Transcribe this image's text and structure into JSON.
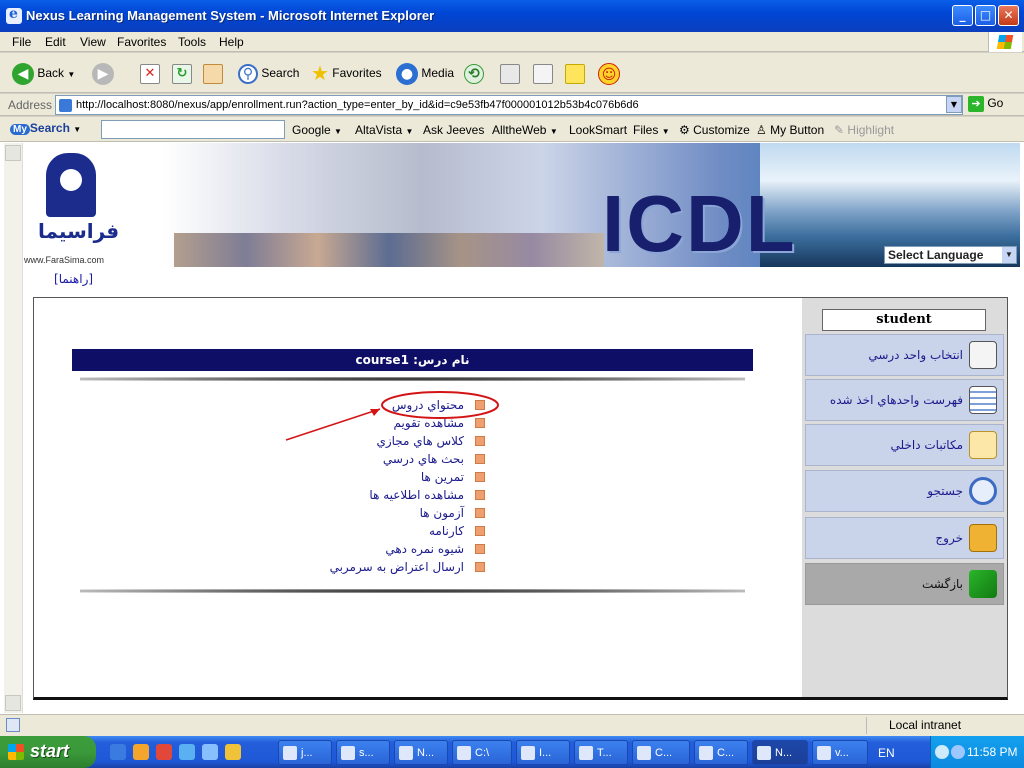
{
  "window": {
    "title": "Nexus Learning Management System - Microsoft Internet Explorer",
    "controls": [
      "minimize",
      "maximize",
      "close"
    ]
  },
  "menubar": [
    "File",
    "Edit",
    "View",
    "Favorites",
    "Tools",
    "Help"
  ],
  "toolbar": {
    "back": "Back",
    "search": "Search",
    "favorites": "Favorites",
    "media": "Media"
  },
  "address": {
    "label": "Address",
    "url": "http://localhost:8080/nexus/app/enrollment.run?action_type=enter_by_id&id=c9e53fb47f000001012b53b4c076b6d6",
    "go": "Go"
  },
  "searchbar": {
    "logo": "Search",
    "logo_prefix": "My",
    "items": [
      "Google",
      "AltaVista",
      "Ask Jeeves",
      "AlltheWeb",
      "LookSmart",
      "Files",
      "Customize",
      "My Button",
      "Highlight"
    ]
  },
  "banner": {
    "logo_text": "فراسیما",
    "logo_url": "www.FaraSima.com",
    "brand": "ICDL",
    "language_select": "Select Language"
  },
  "help_link": "[راهنما]",
  "sidebar": {
    "user": "student",
    "items": [
      {
        "label": "انتخاب واحد درسي",
        "icon": "form-icon"
      },
      {
        "label": "فهرست واحدهاي اخذ شده",
        "icon": "calendar-icon"
      },
      {
        "label": "مكاتبات داخلي",
        "icon": "mail-icon"
      },
      {
        "label": "جستجو",
        "icon": "magnifier-icon"
      },
      {
        "label": "خروج",
        "icon": "key-icon"
      },
      {
        "label": "بازگشت",
        "icon": "back-arrow-icon"
      }
    ]
  },
  "course": {
    "title": "نام درس: course1",
    "menu": [
      "محتواي دروس",
      "مشاهده تقويم",
      "كلاس هاي مجازي",
      "بحث هاي درسي",
      "تمرين ها",
      "مشاهده اطلاعيه ها",
      "آزمون ها",
      "كارنامه",
      "شيوه نمره دهي",
      "ارسال اعتراض به سرمربي"
    ]
  },
  "statusbar": {
    "zone": "Local intranet"
  },
  "taskbar": {
    "start": "start",
    "tasks": [
      "j...",
      "s...",
      "N...",
      "C:\\",
      "I...",
      "T...",
      "C...",
      "C...",
      "N...",
      "v..."
    ],
    "language": "EN",
    "clock": "11:58 PM"
  }
}
